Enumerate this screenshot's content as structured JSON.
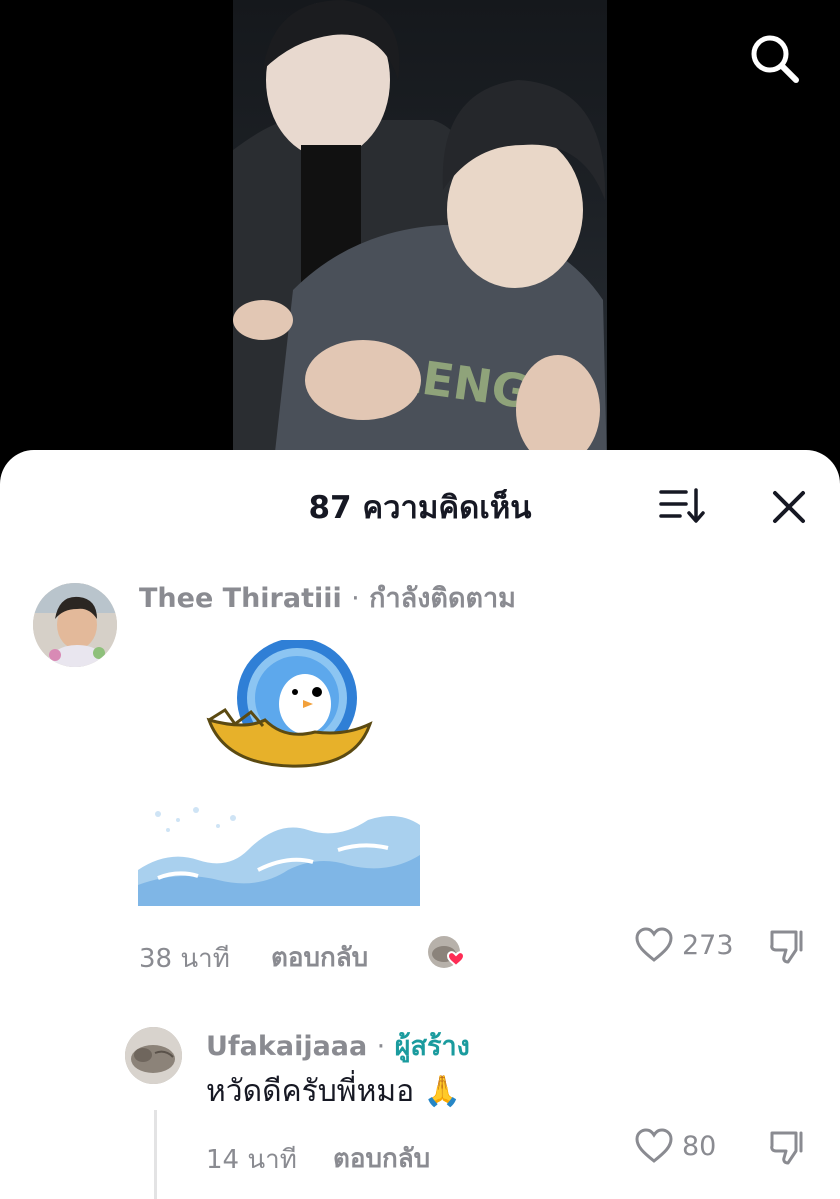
{
  "video": {
    "search_icon": "search-icon"
  },
  "comments_sheet": {
    "title": "87 ความคิดเห็น",
    "sort_icon": "sort-icon",
    "close_icon": "close-icon"
  },
  "comments": [
    {
      "username": "Thee Thiratiii",
      "separator": "·",
      "relation": "กำลังติดตาม",
      "sticker": "penguin-coin-sticker",
      "attachment": "wave-image",
      "time": "38 นาที",
      "reply_label": "ตอบกลับ",
      "like_count": "273",
      "liked_by_creator": true
    },
    {
      "username": "Ufakaijaaa",
      "separator": "·",
      "relation": "ผู้สร้าง",
      "text": "หวัดดีครับพี่หมอ 🙏",
      "time": "14 นาที",
      "reply_label": "ตอบกลับ",
      "like_count": "80"
    }
  ],
  "colors": {
    "creator_badge": "#1a9b9e",
    "meta_text": "#8a8b91",
    "primary_text": "#161823",
    "heart_badge": "#fe2c55"
  }
}
